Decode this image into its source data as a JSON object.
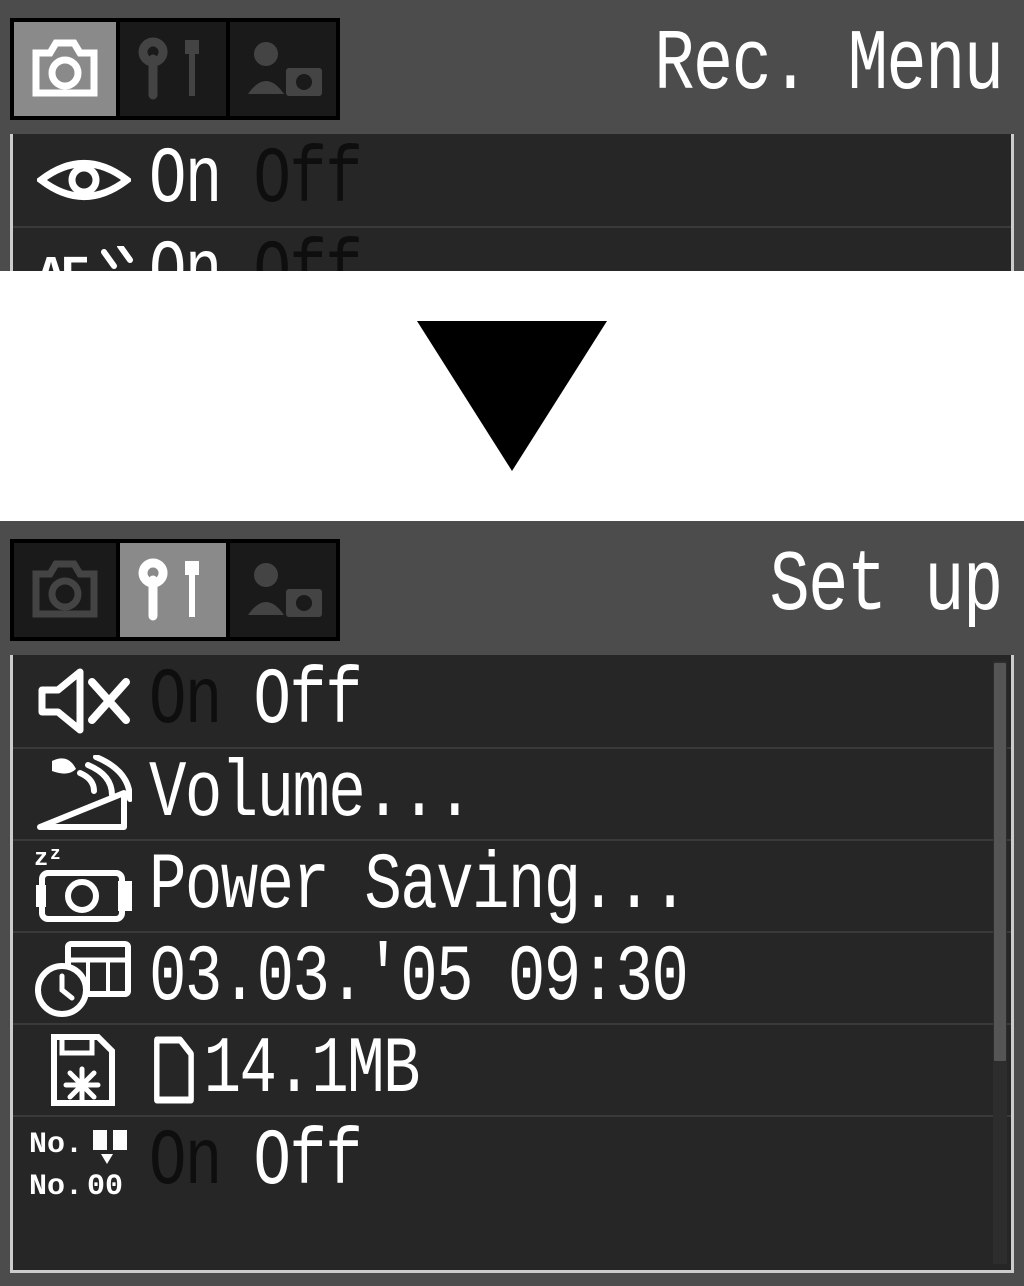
{
  "top": {
    "title": "Rec. Menu",
    "rows": [
      {
        "on": "On",
        "off": "Off",
        "selected": "on"
      },
      {
        "on": "On",
        "off": "Off",
        "selected": "on"
      }
    ]
  },
  "bottom": {
    "title": "Set up",
    "rows": {
      "mute": {
        "on": "On",
        "off": "Off",
        "selected": "off"
      },
      "volume": {
        "label": "Volume..."
      },
      "power": {
        "label": "Power Saving..."
      },
      "datetime": {
        "label": "03.03.'05 09:30"
      },
      "memory": {
        "label": "14.1MB"
      },
      "number": {
        "on": "On",
        "off": "Off",
        "selected": "off"
      }
    }
  }
}
